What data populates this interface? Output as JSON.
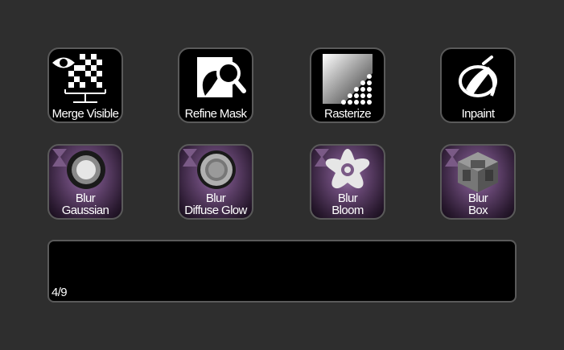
{
  "keys": [
    {
      "id": "merge-visible",
      "lines": [
        "Merge Visible"
      ]
    },
    {
      "id": "refine-mask",
      "lines": [
        "Refine Mask"
      ]
    },
    {
      "id": "rasterize",
      "lines": [
        "Rasterize"
      ]
    },
    {
      "id": "inpaint",
      "lines": [
        "Inpaint"
      ]
    },
    {
      "id": "blur-gaussian",
      "lines": [
        "Blur",
        "Gaussian"
      ]
    },
    {
      "id": "blur-diffuse-glow",
      "lines": [
        "Blur",
        "Diffuse Glow"
      ]
    },
    {
      "id": "blur-bloom",
      "lines": [
        "Blur",
        "Bloom"
      ]
    },
    {
      "id": "blur-box",
      "lines": [
        "Blur",
        "Box"
      ]
    }
  ],
  "display": {
    "page": "4/9"
  },
  "colors": {
    "background": "#2e2e2e",
    "key_border": "#5a5a5a",
    "purple_accent": "#6b4a78"
  }
}
